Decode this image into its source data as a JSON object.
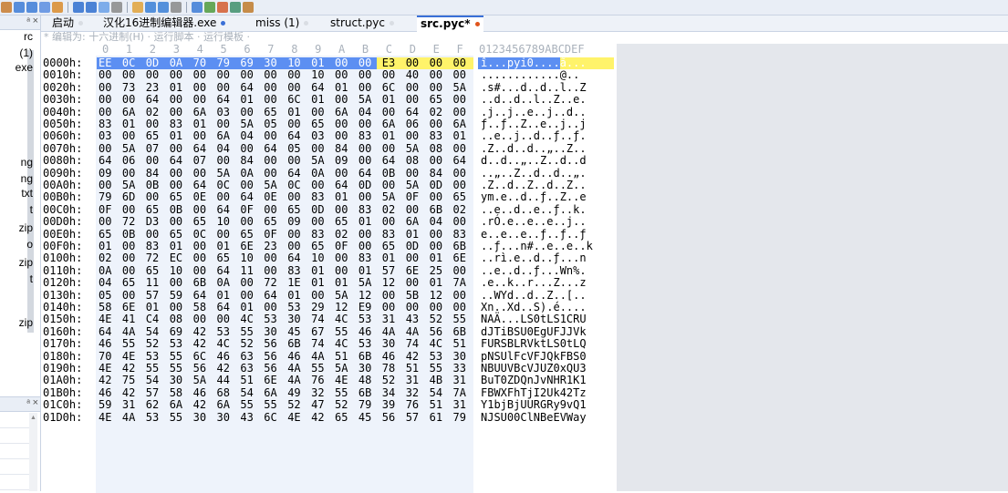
{
  "toolbar": {
    "icons": [
      "cut-icon",
      "copy-icon",
      "paste-icon",
      "undo-icon",
      "redo-icon",
      "find-icon",
      "replace-icon",
      "goto-icon",
      "bookmark-icon",
      "compare-icon",
      "checksum-icon",
      "ascii-table-icon",
      "format-icon",
      "script-icon",
      "template-icon",
      "calculator-icon",
      "histogram-icon",
      "options-icon"
    ]
  },
  "left_panel": {
    "pin_glyph": "ᵃ",
    "close_glyph": "×",
    "items": [
      "rc",
      "(1)",
      "exe",
      "ng",
      "ng",
      "txt",
      "t",
      "zip",
      "o",
      "zip",
      "t",
      "zip"
    ],
    "panel2_pin": "ᵃ",
    "panel2_close": "×"
  },
  "tabs": [
    {
      "label": "启动",
      "dot": "#d9dde3"
    },
    {
      "label": "汉化16进制编辑器.exe",
      "dot": "#3a6fd6"
    },
    {
      "label": "miss (1)",
      "dot": "#d9dde3"
    },
    {
      "label": "struct.pyc",
      "dot": "#d9dde3"
    },
    {
      "label": "src.pyc*",
      "dot": "#e0541c",
      "active": true
    }
  ],
  "edit_hint": "* 编辑为: 十六进制(H) · 运行脚本 · 运行模板 ·",
  "hex": {
    "col_labels": [
      "0",
      "1",
      "2",
      "3",
      "4",
      "5",
      "6",
      "7",
      "8",
      "9",
      "A",
      "B",
      "C",
      "D",
      "E",
      "F"
    ],
    "ascii_header": "0123456789ABCDEF",
    "rows": [
      {
        "addr": "0000h:",
        "bytes": [
          "EE",
          "0C",
          "0D",
          "0A",
          "70",
          "79",
          "69",
          "30",
          "10",
          "01",
          "00",
          "00",
          "E3",
          "00",
          "00",
          "00"
        ],
        "ascii": "î...pyi0....ã..."
      },
      {
        "addr": "0010h:",
        "bytes": [
          "00",
          "00",
          "00",
          "00",
          "00",
          "00",
          "00",
          "00",
          "00",
          "10",
          "00",
          "00",
          "00",
          "40",
          "00",
          "00"
        ],
        "ascii": "............@.."
      },
      {
        "addr": "0020h:",
        "bytes": [
          "00",
          "73",
          "23",
          "01",
          "00",
          "00",
          "64",
          "00",
          "00",
          "64",
          "01",
          "00",
          "6C",
          "00",
          "00",
          "5A"
        ],
        "ascii": ".s#...d..d..l..Z"
      },
      {
        "addr": "0030h:",
        "bytes": [
          "00",
          "00",
          "64",
          "00",
          "00",
          "64",
          "01",
          "00",
          "6C",
          "01",
          "00",
          "5A",
          "01",
          "00",
          "65",
          "00"
        ],
        "ascii": "..d..d..l..Z..e."
      },
      {
        "addr": "0040h:",
        "bytes": [
          "00",
          "6A",
          "02",
          "00",
          "6A",
          "03",
          "00",
          "65",
          "01",
          "00",
          "6A",
          "04",
          "00",
          "64",
          "02",
          "00"
        ],
        "ascii": ".j..j..e..j..d.."
      },
      {
        "addr": "0050h:",
        "bytes": [
          "83",
          "01",
          "00",
          "83",
          "01",
          "00",
          "5A",
          "05",
          "00",
          "65",
          "00",
          "00",
          "6A",
          "06",
          "00",
          "6A"
        ],
        "ascii": "ƒ..ƒ..Z..e..j..j"
      },
      {
        "addr": "0060h:",
        "bytes": [
          "03",
          "00",
          "65",
          "01",
          "00",
          "6A",
          "04",
          "00",
          "64",
          "03",
          "00",
          "83",
          "01",
          "00",
          "83",
          "01"
        ],
        "ascii": "..e..j..d..ƒ..ƒ."
      },
      {
        "addr": "0070h:",
        "bytes": [
          "00",
          "5A",
          "07",
          "00",
          "64",
          "04",
          "00",
          "64",
          "05",
          "00",
          "84",
          "00",
          "00",
          "5A",
          "08",
          "00"
        ],
        "ascii": ".Z..d..d..„..Z.."
      },
      {
        "addr": "0080h:",
        "bytes": [
          "64",
          "06",
          "00",
          "64",
          "07",
          "00",
          "84",
          "00",
          "00",
          "5A",
          "09",
          "00",
          "64",
          "08",
          "00",
          "64"
        ],
        "ascii": "d..d..„..Z..d..d"
      },
      {
        "addr": "0090h:",
        "bytes": [
          "09",
          "00",
          "84",
          "00",
          "00",
          "5A",
          "0A",
          "00",
          "64",
          "0A",
          "00",
          "64",
          "0B",
          "00",
          "84",
          "00"
        ],
        "ascii": "..„..Z..d..d..„."
      },
      {
        "addr": "00A0h:",
        "bytes": [
          "00",
          "5A",
          "0B",
          "00",
          "64",
          "0C",
          "00",
          "5A",
          "0C",
          "00",
          "64",
          "0D",
          "00",
          "5A",
          "0D",
          "00"
        ],
        "ascii": ".Z..d..Z..d..Z.."
      },
      {
        "addr": "00B0h:",
        "bytes": [
          "79",
          "6D",
          "00",
          "65",
          "0E",
          "00",
          "64",
          "0E",
          "00",
          "83",
          "01",
          "00",
          "5A",
          "0F",
          "00",
          "65"
        ],
        "ascii": "ym.e..d..ƒ..Z..e"
      },
      {
        "addr": "00C0h:",
        "bytes": [
          "0F",
          "00",
          "65",
          "0B",
          "00",
          "64",
          "0F",
          "00",
          "65",
          "0D",
          "00",
          "83",
          "02",
          "00",
          "6B",
          "02"
        ],
        "ascii": "..e..d..e..ƒ..k."
      },
      {
        "addr": "00D0h:",
        "bytes": [
          "00",
          "72",
          "D3",
          "00",
          "65",
          "10",
          "00",
          "65",
          "09",
          "00",
          "65",
          "01",
          "00",
          "6A",
          "04",
          "00"
        ],
        "ascii": ".rÓ.e..e..e..j.."
      },
      {
        "addr": "00E0h:",
        "bytes": [
          "65",
          "0B",
          "00",
          "65",
          "0C",
          "00",
          "65",
          "0F",
          "00",
          "83",
          "02",
          "00",
          "83",
          "01",
          "00",
          "83"
        ],
        "ascii": "e..e..e..ƒ..ƒ..ƒ"
      },
      {
        "addr": "00F0h:",
        "bytes": [
          "01",
          "00",
          "83",
          "01",
          "00",
          "01",
          "6E",
          "23",
          "00",
          "65",
          "0F",
          "00",
          "65",
          "0D",
          "00",
          "6B"
        ],
        "ascii": "..ƒ...n#..e..e..k"
      },
      {
        "addr": "0100h:",
        "bytes": [
          "02",
          "00",
          "72",
          "EC",
          "00",
          "65",
          "10",
          "00",
          "64",
          "10",
          "00",
          "83",
          "01",
          "00",
          "01",
          "6E"
        ],
        "ascii": "..rì.e..d..ƒ...n"
      },
      {
        "addr": "0110h:",
        "bytes": [
          "0A",
          "00",
          "65",
          "10",
          "00",
          "64",
          "11",
          "00",
          "83",
          "01",
          "00",
          "01",
          "57",
          "6E",
          "25",
          "00"
        ],
        "ascii": "..e..d..ƒ...Wn%."
      },
      {
        "addr": "0120h:",
        "bytes": [
          "04",
          "65",
          "11",
          "00",
          "6B",
          "0A",
          "00",
          "72",
          "1E",
          "01",
          "01",
          "5A",
          "12",
          "00",
          "01",
          "7A"
        ],
        "ascii": ".e..k..r...Z...z"
      },
      {
        "addr": "0130h:",
        "bytes": [
          "05",
          "00",
          "57",
          "59",
          "64",
          "01",
          "00",
          "64",
          "01",
          "00",
          "5A",
          "12",
          "00",
          "5B",
          "12",
          "00"
        ],
        "ascii": "..WYd..d..Z..[.."
      },
      {
        "addr": "0140h:",
        "bytes": [
          "58",
          "6E",
          "01",
          "00",
          "58",
          "64",
          "01",
          "00",
          "53",
          "29",
          "12",
          "E9",
          "00",
          "00",
          "00",
          "00"
        ],
        "ascii": "Xn..Xd..S).é...."
      },
      {
        "addr": "0150h:",
        "bytes": [
          "4E",
          "41",
          "C4",
          "08",
          "00",
          "00",
          "4C",
          "53",
          "30",
          "74",
          "4C",
          "53",
          "31",
          "43",
          "52",
          "55"
        ],
        "ascii": "NAÄ...LS0tLS1CRU"
      },
      {
        "addr": "0160h:",
        "bytes": [
          "64",
          "4A",
          "54",
          "69",
          "42",
          "53",
          "55",
          "30",
          "45",
          "67",
          "55",
          "46",
          "4A",
          "4A",
          "56",
          "6B"
        ],
        "ascii": "dJTiBSU0EgUFJJVk"
      },
      {
        "addr": "0170h:",
        "bytes": [
          "46",
          "55",
          "52",
          "53",
          "42",
          "4C",
          "52",
          "56",
          "6B",
          "74",
          "4C",
          "53",
          "30",
          "74",
          "4C",
          "51"
        ],
        "ascii": "FURSBLRVktLS0tLQ"
      },
      {
        "addr": "0180h:",
        "bytes": [
          "70",
          "4E",
          "53",
          "55",
          "6C",
          "46",
          "63",
          "56",
          "46",
          "4A",
          "51",
          "6B",
          "46",
          "42",
          "53",
          "30"
        ],
        "ascii": "pNSUlFcVFJQkFBS0"
      },
      {
        "addr": "0190h:",
        "bytes": [
          "4E",
          "42",
          "55",
          "55",
          "56",
          "42",
          "63",
          "56",
          "4A",
          "55",
          "5A",
          "30",
          "78",
          "51",
          "55",
          "33"
        ],
        "ascii": "NBUUVBcVJUZ0xQU3"
      },
      {
        "addr": "01A0h:",
        "bytes": [
          "42",
          "75",
          "54",
          "30",
          "5A",
          "44",
          "51",
          "6E",
          "4A",
          "76",
          "4E",
          "48",
          "52",
          "31",
          "4B",
          "31"
        ],
        "ascii": "BuT0ZDQnJvNHR1K1"
      },
      {
        "addr": "01B0h:",
        "bytes": [
          "46",
          "42",
          "57",
          "58",
          "46",
          "68",
          "54",
          "6A",
          "49",
          "32",
          "55",
          "6B",
          "34",
          "32",
          "54",
          "7A"
        ],
        "ascii": "FBWXFhTjI2Uk42Tz"
      },
      {
        "addr": "01C0h:",
        "bytes": [
          "59",
          "31",
          "62",
          "6A",
          "42",
          "6A",
          "55",
          "55",
          "52",
          "47",
          "52",
          "79",
          "39",
          "76",
          "51",
          "31"
        ],
        "ascii": "Y1bjBjUURGRy9vQ1"
      },
      {
        "addr": "01D0h:",
        "bytes": [
          "4E",
          "4A",
          "53",
          "55",
          "30",
          "30",
          "43",
          "6C",
          "4E",
          "42",
          "65",
          "45",
          "56",
          "57",
          "61",
          "79"
        ],
        "ascii": "NJSU00ClNBeEVWay"
      }
    ]
  },
  "colors": {
    "selection_blue": "#5c8ff2",
    "selection_yellow": "#fff36a",
    "panel_bg": "#e4e7ec"
  }
}
